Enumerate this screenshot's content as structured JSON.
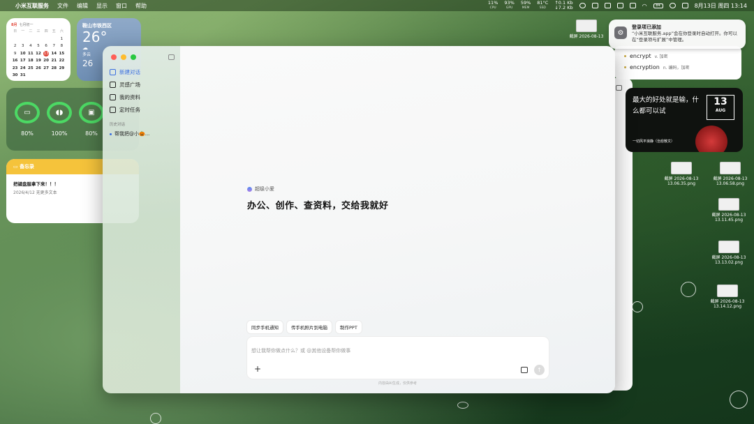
{
  "menubar": {
    "app_name": "小米互联服务",
    "menus": [
      "文件",
      "编辑",
      "显示",
      "窗口",
      "帮助"
    ],
    "stats": [
      {
        "value": "11%",
        "label": "CPU"
      },
      {
        "value": "93%",
        "label": "GPU"
      },
      {
        "value": "59%",
        "label": "MEM"
      },
      {
        "value": "81°C",
        "label": "SSD"
      }
    ],
    "net_up": "↑0.1 Kb",
    "net_down": "↓7.2 Kb",
    "battery": "84",
    "datetime": "8月13日 周四 13:14"
  },
  "calendar": {
    "month": "8月",
    "lunar": "七月初一",
    "weekdays": [
      "日",
      "一",
      "二",
      "三",
      "四",
      "五",
      "六"
    ],
    "today": 13
  },
  "weather": {
    "city": "鞍山市铁西区",
    "temp": "26°",
    "condition": "多云",
    "temp2": "26"
  },
  "batteries": [
    {
      "icon": "laptop-icon",
      "glyph": "▭",
      "pct": "80%"
    },
    {
      "icon": "airpods-icon",
      "glyph": "◖◗",
      "pct": "100%"
    },
    {
      "icon": "case-icon",
      "glyph": "▣",
      "pct": "80%"
    }
  ],
  "notes": {
    "title": "备忘录",
    "item_title": "把键盘服拿下来！！！",
    "item_sub": "2026/4/12  无更多文本"
  },
  "notification": {
    "title": "登录项已添加",
    "text": "“小米互联服务.app”会在你登录时自动打开。你可以在“登录项与扩展”中管理。"
  },
  "dictionary": [
    {
      "word": "encrypt",
      "def": "v. 加密"
    },
    {
      "word": "encryption",
      "def": "n. 编码，加密"
    }
  ],
  "quote": {
    "text": "最大的好处就是输，什么都可以试",
    "day": "13",
    "month": "AUG",
    "caption": "一切风平浪静（治愈散文）"
  },
  "desktop_files": [
    {
      "name": "截屏 2026-08-13",
      "sub": ""
    },
    {
      "name": "截屏 2026-08-13",
      "sub": "13.06.35.png"
    },
    {
      "name": "截屏 2026-08-13",
      "sub": "13.06.58.png"
    },
    {
      "name": "截屏 2026-08-13",
      "sub": "13.11.45.png"
    },
    {
      "name": "截屏 2026-08-13",
      "sub": "13.13.02.png"
    },
    {
      "name": "截屏 2026-08-13",
      "sub": "13.14.12.png"
    }
  ],
  "sidebar": {
    "items": [
      {
        "label": "新建对话",
        "active": true
      },
      {
        "label": "灵感广场",
        "active": false
      },
      {
        "label": "我的资料",
        "active": false
      },
      {
        "label": "定时任务",
        "active": false
      }
    ],
    "history_label": "历史对话",
    "history": [
      "帮我把@小🎃..."
    ]
  },
  "main": {
    "assistant_name": "超级小爱",
    "headline": "办公、创作、查资料，交给我就好",
    "chips": [
      "同步手机通知",
      "传手机照片到电脑",
      "制作PPT"
    ],
    "input_placeholder": "想让我帮你做点什么？或 @其他设备帮你做事",
    "disclaimer": "内容由AI生成，仅供参考"
  },
  "colors": {
    "accent": "#3b6fe0",
    "ring": "#4cd964",
    "today": "#e04437"
  }
}
